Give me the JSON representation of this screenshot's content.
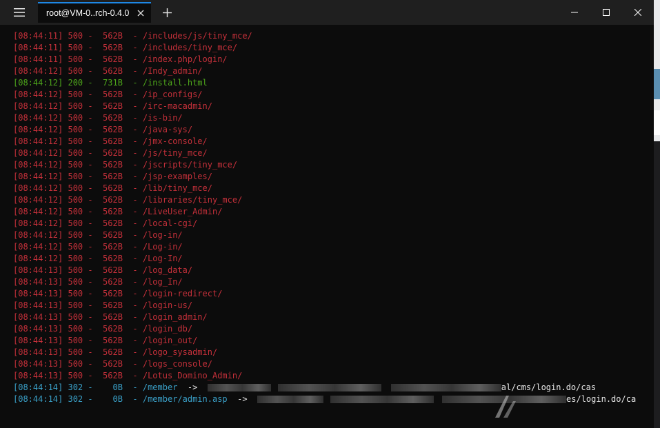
{
  "titlebar": {
    "tab_title": "root@VM-0..rch-0.4.0",
    "menu_icon": "hamburger-menu-icon",
    "close_tab_icon": "close-icon",
    "new_tab_icon": "plus-icon",
    "window_controls": [
      "minimize-icon",
      "maximize-icon",
      "close-icon"
    ]
  },
  "colors": {
    "status_500": "#c5303a",
    "status_200": "#4ea61b",
    "status_302": "#3aa0c8",
    "redirect_text": "#e8e8e8",
    "tab_accent": "#1e88e5"
  },
  "terminal": {
    "lines": [
      {
        "text": "[08:44:11] 500 -  562B  - /includes/js/tiny_mce/",
        "status": "500"
      },
      {
        "text": "[08:44:11] 500 -  562B  - /includes/tiny_mce/",
        "status": "500"
      },
      {
        "text": "[08:44:11] 500 -  562B  - /index.php/login/",
        "status": "500"
      },
      {
        "text": "[08:44:12] 500 -  562B  - /Indy_admin/",
        "status": "500"
      },
      {
        "text": "[08:44:12] 200 -  731B  - /install.html",
        "status": "200"
      },
      {
        "text": "[08:44:12] 500 -  562B  - /ip_configs/",
        "status": "500"
      },
      {
        "text": "[08:44:12] 500 -  562B  - /irc-macadmin/",
        "status": "500"
      },
      {
        "text": "[08:44:12] 500 -  562B  - /is-bin/",
        "status": "500"
      },
      {
        "text": "[08:44:12] 500 -  562B  - /java-sys/",
        "status": "500"
      },
      {
        "text": "[08:44:12] 500 -  562B  - /jmx-console/",
        "status": "500"
      },
      {
        "text": "[08:44:12] 500 -  562B  - /js/tiny_mce/",
        "status": "500"
      },
      {
        "text": "[08:44:12] 500 -  562B  - /jscripts/tiny_mce/",
        "status": "500"
      },
      {
        "text": "[08:44:12] 500 -  562B  - /jsp-examples/",
        "status": "500"
      },
      {
        "text": "[08:44:12] 500 -  562B  - /lib/tiny_mce/",
        "status": "500"
      },
      {
        "text": "[08:44:12] 500 -  562B  - /libraries/tiny_mce/",
        "status": "500"
      },
      {
        "text": "[08:44:12] 500 -  562B  - /LiveUser_Admin/",
        "status": "500"
      },
      {
        "text": "[08:44:12] 500 -  562B  - /local-cgi/",
        "status": "500"
      },
      {
        "text": "[08:44:12] 500 -  562B  - /log-in/",
        "status": "500"
      },
      {
        "text": "[08:44:12] 500 -  562B  - /Log-in/",
        "status": "500"
      },
      {
        "text": "[08:44:12] 500 -  562B  - /Log-In/",
        "status": "500"
      },
      {
        "text": "[08:44:13] 500 -  562B  - /log_data/",
        "status": "500"
      },
      {
        "text": "[08:44:13] 500 -  562B  - /log_In/",
        "status": "500"
      },
      {
        "text": "[08:44:13] 500 -  562B  - /login-redirect/",
        "status": "500"
      },
      {
        "text": "[08:44:13] 500 -  562B  - /login-us/",
        "status": "500"
      },
      {
        "text": "[08:44:13] 500 -  562B  - /login_admin/",
        "status": "500"
      },
      {
        "text": "[08:44:13] 500 -  562B  - /login_db/",
        "status": "500"
      },
      {
        "text": "[08:44:13] 500 -  562B  - /login_out/",
        "status": "500"
      },
      {
        "text": "[08:44:13] 500 -  562B  - /logo_sysadmin/",
        "status": "500"
      },
      {
        "text": "[08:44:13] 500 -  562B  - /logs_console/",
        "status": "500"
      },
      {
        "text": "[08:44:13] 500 -  562B  - /Lotus_Domino_Admin/",
        "status": "500"
      }
    ],
    "redirects": [
      {
        "prefix": "[08:44:14] 302 -    0B  - /member",
        "arrow": "  ->  ",
        "target_tail": "al/cms/login.do/cas"
      },
      {
        "prefix": "[08:44:14] 302 -    0B  - /member/admin.asp",
        "arrow": "  ->  ",
        "target_tail": "es/login.do/ca"
      }
    ]
  },
  "watermark": {
    "logo_icon": "xianzhi-logo-icon"
  }
}
